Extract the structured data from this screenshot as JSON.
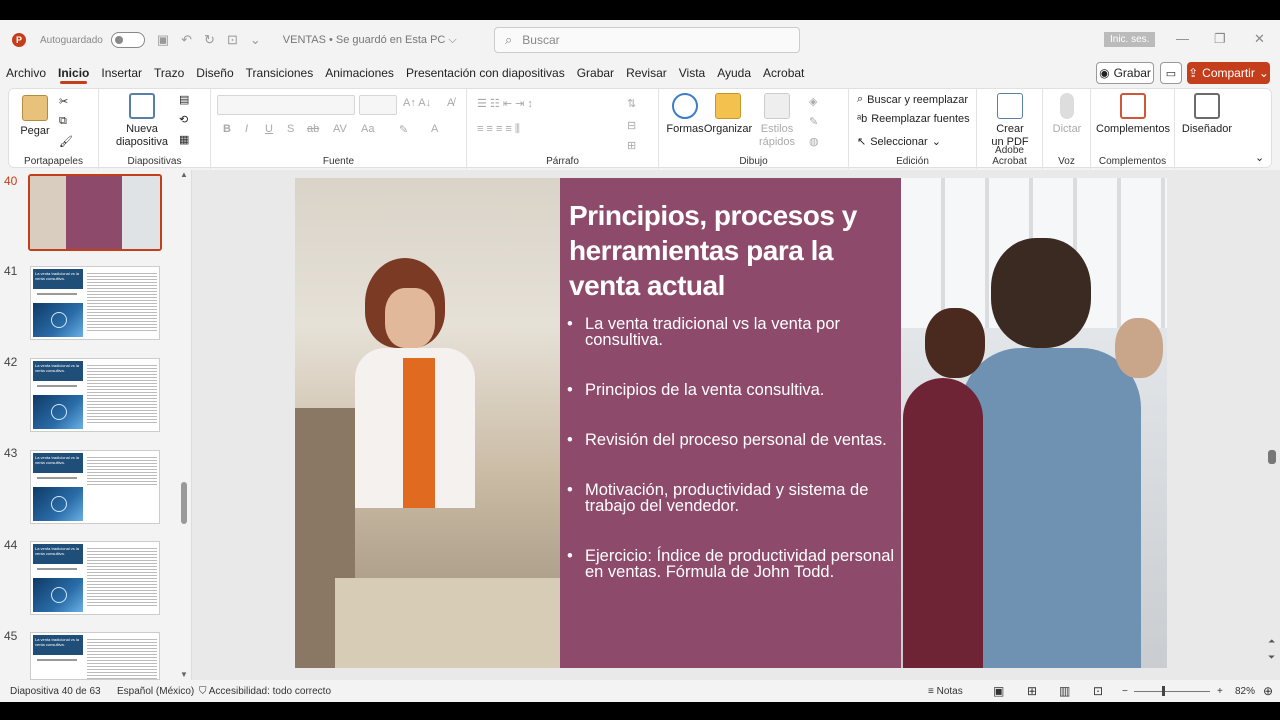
{
  "app": {
    "logo": "P",
    "autosave_label": "Autoguardado",
    "doc_title": "VENTAS • Se guardó en Esta PC ⌵",
    "search_placeholder": "Buscar",
    "signin": "Inic. ses."
  },
  "tabs": [
    "Archivo",
    "Inicio",
    "Insertar",
    "Trazo",
    "Diseño",
    "Transiciones",
    "Animaciones",
    "Presentación con diapositivas",
    "Grabar",
    "Revisar",
    "Vista",
    "Ayuda",
    "Acrobat"
  ],
  "active_tab": "Inicio",
  "right_buttons": {
    "record": "Grabar",
    "share": "Compartir"
  },
  "ribbon": {
    "paste": "Pegar",
    "portapapeles": "Portapapeles",
    "new_slide": [
      "Nueva",
      "diapositiva"
    ],
    "diapositivas": "Diapositivas",
    "fuente": "Fuente",
    "parrafo": "Párrafo",
    "formas": "Formas",
    "organizar": "Organizar",
    "estilos": [
      "Estilos",
      "rápidos"
    ],
    "dibujo": "Dibujo",
    "buscar_reemplazar": "Buscar y reemplazar",
    "reemplazar_fuentes": "Reemplazar fuentes",
    "seleccionar": "Seleccionar",
    "edicion": "Edición",
    "crear_pdf": [
      "Crear",
      "un PDF"
    ],
    "adobe": "Adobe Acrobat",
    "dictar": "Dictar",
    "voz": "Voz",
    "complementos": "Complementos",
    "complementos_group": "Complementos",
    "disenador": "Diseñador"
  },
  "thumbnails": [
    {
      "num": "40",
      "current": true
    },
    {
      "num": "41",
      "title": "La venta tradicional vs la venta consultiva."
    },
    {
      "num": "42",
      "title": "La venta tradicional vs la venta consultiva."
    },
    {
      "num": "43",
      "title": "La venta tradicional vs la venta consultiva."
    },
    {
      "num": "44",
      "title": "La venta tradicional vs la venta consultiva."
    },
    {
      "num": "45",
      "title": "La venta tradicional vs la venta consultiva."
    }
  ],
  "slide": {
    "title": "Principios, procesos y herramientas para la venta actual",
    "bullets": [
      "La venta tradicional vs la venta por consultiva.",
      "Principios de la venta consultiva.",
      "Revisión del proceso personal de ventas.",
      "Motivación, productividad y sistema de trabajo del vendedor.",
      "Ejercicio: Índice de productividad personal en ventas. Fórmula de John Todd."
    ]
  },
  "status": {
    "slide_count": "Diapositiva 40 de 63",
    "language": "Español (México)",
    "accessibility": "Accesibilidad: todo correcto",
    "notes": "Notas",
    "zoom": "82%"
  },
  "colors": {
    "accent": "#c43e1c",
    "slide_panel": "#8e4a6b"
  }
}
